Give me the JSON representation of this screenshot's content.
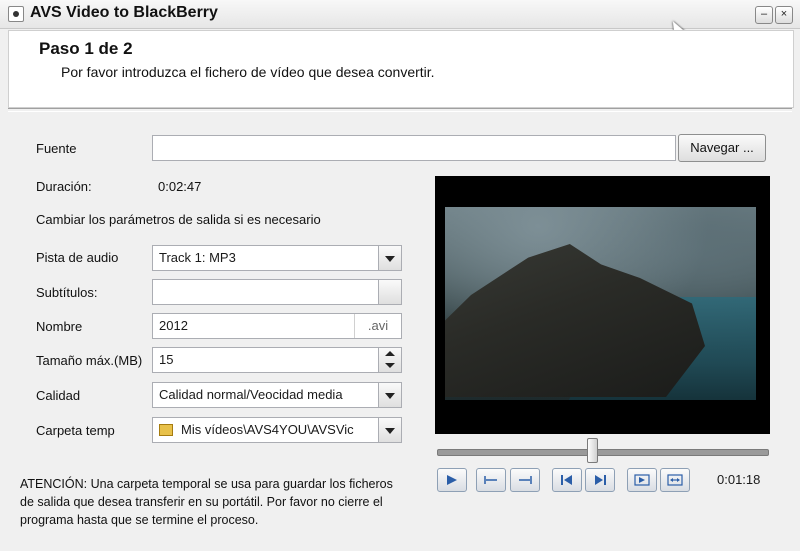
{
  "window": {
    "title": "AVS Video to BlackBerry",
    "minimize": "–",
    "close": "×"
  },
  "header": {
    "step": "Paso 1 de 2",
    "description": "Por favor introduzca el fichero de vídeo que desea convertir."
  },
  "form": {
    "source": {
      "label": "Fuente",
      "value": "",
      "browse": "Navegar ..."
    },
    "duration": {
      "label": "Duración:",
      "value": "0:02:47"
    },
    "hint": "Cambiar los parámetros de salida si es necesario",
    "audio": {
      "label": "Pista de audio",
      "value": "Track 1: MP3"
    },
    "subtitles": {
      "label": "Subtítulos:",
      "value": ""
    },
    "name": {
      "label": "Nombre",
      "value": "2012",
      "extension": ".avi"
    },
    "max_size": {
      "label": "Tamaño máx.(MB)",
      "value": "15"
    },
    "quality": {
      "label": "Calidad",
      "value": "Calidad normal/Veocidad media"
    },
    "temp_folder": {
      "label": "Carpeta temp",
      "value": "Mis vídeos\\AVS4YOU\\AVSVic"
    }
  },
  "note": "ATENCIÓN: Una carpeta temporal se usa para guardar los ficheros de salida que desea transferir en su portátil. Por favor no cierre el programa hasta que se termine el proceso.",
  "player": {
    "time": "0:01:18",
    "progress": 0.47
  },
  "icons": [
    "play-icon",
    "set-start-icon",
    "set-end-icon",
    "prev-frame-icon",
    "next-frame-icon",
    "go-marker-icon",
    "fit-icon"
  ]
}
